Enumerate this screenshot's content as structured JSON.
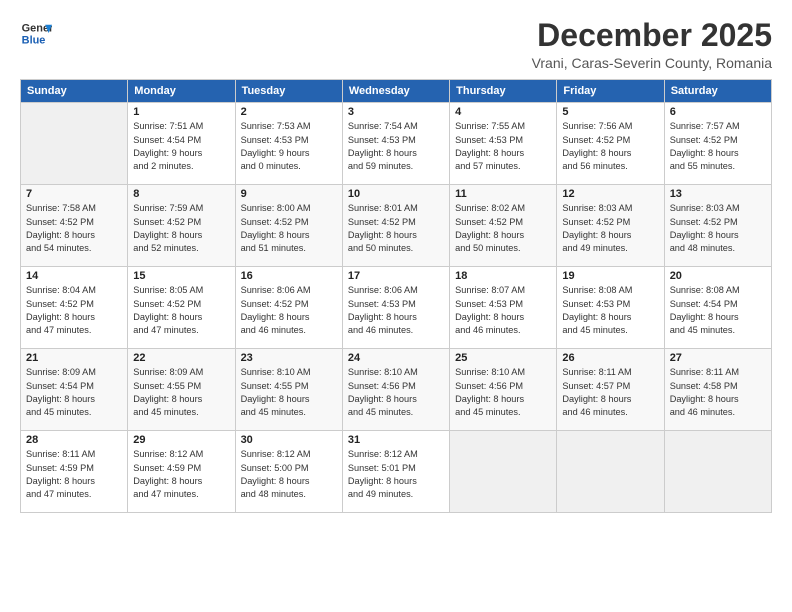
{
  "logo": {
    "line1": "General",
    "line2": "Blue"
  },
  "title": "December 2025",
  "subtitle": "Vrani, Caras-Severin County, Romania",
  "days_header": [
    "Sunday",
    "Monday",
    "Tuesday",
    "Wednesday",
    "Thursday",
    "Friday",
    "Saturday"
  ],
  "weeks": [
    [
      {
        "day": "",
        "info": ""
      },
      {
        "day": "1",
        "info": "Sunrise: 7:51 AM\nSunset: 4:54 PM\nDaylight: 9 hours\nand 2 minutes."
      },
      {
        "day": "2",
        "info": "Sunrise: 7:53 AM\nSunset: 4:53 PM\nDaylight: 9 hours\nand 0 minutes."
      },
      {
        "day": "3",
        "info": "Sunrise: 7:54 AM\nSunset: 4:53 PM\nDaylight: 8 hours\nand 59 minutes."
      },
      {
        "day": "4",
        "info": "Sunrise: 7:55 AM\nSunset: 4:53 PM\nDaylight: 8 hours\nand 57 minutes."
      },
      {
        "day": "5",
        "info": "Sunrise: 7:56 AM\nSunset: 4:52 PM\nDaylight: 8 hours\nand 56 minutes."
      },
      {
        "day": "6",
        "info": "Sunrise: 7:57 AM\nSunset: 4:52 PM\nDaylight: 8 hours\nand 55 minutes."
      }
    ],
    [
      {
        "day": "7",
        "info": "Sunrise: 7:58 AM\nSunset: 4:52 PM\nDaylight: 8 hours\nand 54 minutes."
      },
      {
        "day": "8",
        "info": "Sunrise: 7:59 AM\nSunset: 4:52 PM\nDaylight: 8 hours\nand 52 minutes."
      },
      {
        "day": "9",
        "info": "Sunrise: 8:00 AM\nSunset: 4:52 PM\nDaylight: 8 hours\nand 51 minutes."
      },
      {
        "day": "10",
        "info": "Sunrise: 8:01 AM\nSunset: 4:52 PM\nDaylight: 8 hours\nand 50 minutes."
      },
      {
        "day": "11",
        "info": "Sunrise: 8:02 AM\nSunset: 4:52 PM\nDaylight: 8 hours\nand 50 minutes."
      },
      {
        "day": "12",
        "info": "Sunrise: 8:03 AM\nSunset: 4:52 PM\nDaylight: 8 hours\nand 49 minutes."
      },
      {
        "day": "13",
        "info": "Sunrise: 8:03 AM\nSunset: 4:52 PM\nDaylight: 8 hours\nand 48 minutes."
      }
    ],
    [
      {
        "day": "14",
        "info": "Sunrise: 8:04 AM\nSunset: 4:52 PM\nDaylight: 8 hours\nand 47 minutes."
      },
      {
        "day": "15",
        "info": "Sunrise: 8:05 AM\nSunset: 4:52 PM\nDaylight: 8 hours\nand 47 minutes."
      },
      {
        "day": "16",
        "info": "Sunrise: 8:06 AM\nSunset: 4:52 PM\nDaylight: 8 hours\nand 46 minutes."
      },
      {
        "day": "17",
        "info": "Sunrise: 8:06 AM\nSunset: 4:53 PM\nDaylight: 8 hours\nand 46 minutes."
      },
      {
        "day": "18",
        "info": "Sunrise: 8:07 AM\nSunset: 4:53 PM\nDaylight: 8 hours\nand 46 minutes."
      },
      {
        "day": "19",
        "info": "Sunrise: 8:08 AM\nSunset: 4:53 PM\nDaylight: 8 hours\nand 45 minutes."
      },
      {
        "day": "20",
        "info": "Sunrise: 8:08 AM\nSunset: 4:54 PM\nDaylight: 8 hours\nand 45 minutes."
      }
    ],
    [
      {
        "day": "21",
        "info": "Sunrise: 8:09 AM\nSunset: 4:54 PM\nDaylight: 8 hours\nand 45 minutes."
      },
      {
        "day": "22",
        "info": "Sunrise: 8:09 AM\nSunset: 4:55 PM\nDaylight: 8 hours\nand 45 minutes."
      },
      {
        "day": "23",
        "info": "Sunrise: 8:10 AM\nSunset: 4:55 PM\nDaylight: 8 hours\nand 45 minutes."
      },
      {
        "day": "24",
        "info": "Sunrise: 8:10 AM\nSunset: 4:56 PM\nDaylight: 8 hours\nand 45 minutes."
      },
      {
        "day": "25",
        "info": "Sunrise: 8:10 AM\nSunset: 4:56 PM\nDaylight: 8 hours\nand 45 minutes."
      },
      {
        "day": "26",
        "info": "Sunrise: 8:11 AM\nSunset: 4:57 PM\nDaylight: 8 hours\nand 46 minutes."
      },
      {
        "day": "27",
        "info": "Sunrise: 8:11 AM\nSunset: 4:58 PM\nDaylight: 8 hours\nand 46 minutes."
      }
    ],
    [
      {
        "day": "28",
        "info": "Sunrise: 8:11 AM\nSunset: 4:59 PM\nDaylight: 8 hours\nand 47 minutes."
      },
      {
        "day": "29",
        "info": "Sunrise: 8:12 AM\nSunset: 4:59 PM\nDaylight: 8 hours\nand 47 minutes."
      },
      {
        "day": "30",
        "info": "Sunrise: 8:12 AM\nSunset: 5:00 PM\nDaylight: 8 hours\nand 48 minutes."
      },
      {
        "day": "31",
        "info": "Sunrise: 8:12 AM\nSunset: 5:01 PM\nDaylight: 8 hours\nand 49 minutes."
      },
      {
        "day": "",
        "info": ""
      },
      {
        "day": "",
        "info": ""
      },
      {
        "day": "",
        "info": ""
      }
    ]
  ]
}
